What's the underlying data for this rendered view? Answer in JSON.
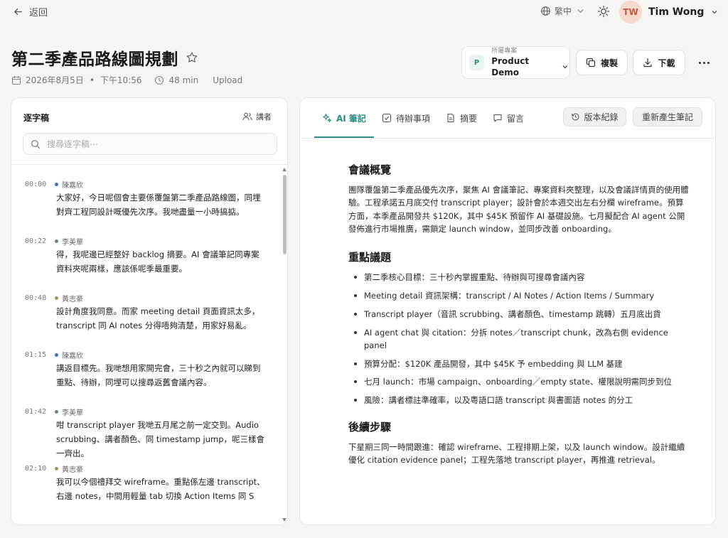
{
  "topbar": {
    "back_label": "返回",
    "language": "繁中",
    "user": {
      "initials": "TW",
      "name": "Tim Wong"
    }
  },
  "header": {
    "title": "第二季產品路線圖規劃",
    "date": "2026年8月5日",
    "time": "下午10:56",
    "duration": "48 min",
    "source": "Upload"
  },
  "project": {
    "label": "所屬專案",
    "badge": "P",
    "name": "Product Demo"
  },
  "actions": {
    "copy_label": "複製",
    "download_label": "下載"
  },
  "transcript": {
    "heading": "逐字稿",
    "speakers_label": "講者",
    "search_placeholder": "搜尋逐字稿⋯",
    "entries": [
      {
        "time": "00:00",
        "speaker": "陳嘉欣",
        "color": "#3b6fd6",
        "text": "大家好，今日呢個會主要係覆盤第二季產品路線圖，同埋對齊工程同設計嘅優先次序。我哋盡量一小時搞掂。"
      },
      {
        "time": "00:22",
        "speaker": "李美華",
        "color": "#5a8f6e",
        "text": "得，我呢邊已經整好 backlog 摘要。AI 會議筆記同專案資料夾呢兩樣，應該係呢季最重要。"
      },
      {
        "time": "00:48",
        "speaker": "黃志豪",
        "color": "#b08d4a",
        "text": "設計角度我同意。而家 meeting detail 頁面資訊太多，transcript 同 AI notes 分得唔夠清楚，用家好易亂。"
      },
      {
        "time": "01:15",
        "speaker": "陳嘉欣",
        "color": "#3b6fd6",
        "text": "講返目標先。我哋想用家開完會，三十秒之內就可以睇到重點、待辦，同埋可以搜尋返舊會議內容。"
      },
      {
        "time": "01:42",
        "speaker": "李美華",
        "color": "#5a8f6e",
        "text": "咁 transcript player 我哋五月尾之前一定交到。Audio scrubbing、講者顏色、同 timestamp jump，呢三樣會一齊出。"
      },
      {
        "time": "02:10",
        "speaker": "黃志豪",
        "color": "#b08d4a",
        "text": "我可以今個禮拜交 wireframe。重點係左邊 transcript、右邊 notes，中間用輕量 tab 切換 Action Items 同 S"
      }
    ]
  },
  "tabs": [
    {
      "label": "AI 筆記",
      "icon": "sparkle-icon",
      "active": true
    },
    {
      "label": "待辦事項",
      "icon": "checkbox-icon",
      "active": false
    },
    {
      "label": "摘要",
      "icon": "document-icon",
      "active": false
    },
    {
      "label": "留言",
      "icon": "comment-icon",
      "active": false
    }
  ],
  "notes_toolbar": {
    "history_label": "版本紀錄",
    "regenerate_label": "重新產生筆記"
  },
  "notes": {
    "overview_heading": "會議概覽",
    "overview_text": "團隊覆盤第二季產品優先次序，聚焦 AI 會議筆記、專案資料夾整理，以及會議詳情頁的使用體驗。工程承諾五月底交付 transcript player；設計會於本週交出左右分欄 wireframe。預算方面，本季產品開發共 $120K，其中 $45K 預留作 AI 基礎設施。七月擬配合 AI agent 公開發佈進行市場推廣，需鎖定 launch window，並同步改善 onboarding。",
    "issues_heading": "重點議題",
    "issues": [
      "第二季核心目標：三十秒內掌握重點、待辦與可搜尋會議內容",
      "Meeting detail 資訊架構：transcript / AI Notes / Action Items / Summary",
      "Transcript player（音訊 scrubbing、講者顏色、timestamp 跳轉）五月底出貨",
      "AI agent chat 與 citation：分拆 notes／transcript chunk，改為右側 evidence panel",
      "預算分配：$120K 產品開發，其中 $45K 予 embedding 與 LLM 基建",
      "七月 launch：市場 campaign、onboarding／empty state、權限說明需同步到位",
      "風險：講者標註準確率，以及粵語口語 transcript 與書面語 notes 的分工"
    ],
    "next_heading": "後續步驟",
    "next_text": "下星期三同一時間跟進：確認 wireframe、工程排期上架，以及 launch window。設計繼續優化 citation evidence panel；工程先落地 transcript player，再推進 retrieval。"
  },
  "accent_color": "#2b8c82"
}
